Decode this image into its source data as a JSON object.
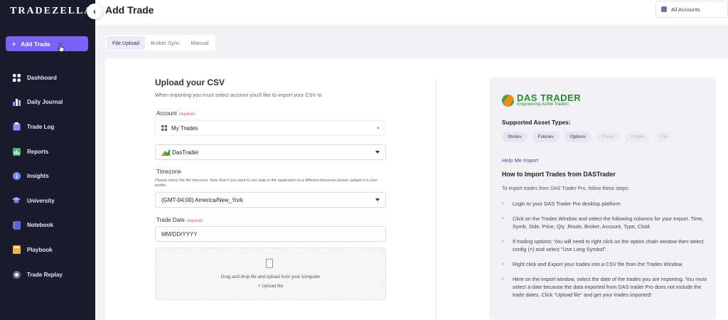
{
  "app": {
    "logo_text": "TRADEZELLA"
  },
  "sidebar": {
    "add_trade_label": "Add Trade",
    "items": [
      {
        "label": "Dashboard",
        "icon": "dashboard-icon"
      },
      {
        "label": "Daily Journal",
        "icon": "bar-chart-icon"
      },
      {
        "label": "Trade Log",
        "icon": "clipboard-icon"
      },
      {
        "label": "Reports",
        "icon": "report-icon"
      },
      {
        "label": "Insights",
        "icon": "info-icon"
      },
      {
        "label": "University",
        "icon": "graduation-cap-icon"
      },
      {
        "label": "Notebook",
        "icon": "notebook-icon"
      },
      {
        "label": "Playbook",
        "icon": "playbook-icon"
      },
      {
        "label": "Trade Replay",
        "icon": "replay-icon"
      }
    ]
  },
  "header": {
    "title": "Add Trade",
    "account_selector": "All Accounts"
  },
  "tabs": [
    "File Upload",
    "Broker Sync",
    "Manual"
  ],
  "form": {
    "title": "Upload your CSV",
    "subtitle": "When importing you must select account you'll like to import your CSV to",
    "account_label": "Account",
    "required_text": "required",
    "account_value": "My Trades",
    "broker_value": "DasTrader",
    "timezone_label": "Timezone",
    "timezone_help": "Please select the file timezone. Note that if you want to see data in the application in a different timezone please update it in your profile.",
    "timezone_value": "(GMT-04:00) America/New_York",
    "trade_date_label": "Trade Date",
    "trade_date_placeholder": "MM/DD/YYYY",
    "dropzone_text": "Drag and drop file and upload from your computer",
    "upload_link": "+ Upload file"
  },
  "info_panel": {
    "brand_name": "DAS TRADER",
    "brand_tagline": "Empowering Active Traders",
    "supported_title": "Supported Asset Types:",
    "asset_types": [
      {
        "label": "Stocks",
        "enabled": true
      },
      {
        "label": "Futures",
        "enabled": true
      },
      {
        "label": "Options",
        "enabled": true
      },
      {
        "label": "Forex",
        "enabled": false
      },
      {
        "label": "Crypto",
        "enabled": false
      },
      {
        "label": "Cfd",
        "enabled": false
      }
    ],
    "help_link": "Help Me Import",
    "how_title": "How to Import Trades from DASTrader",
    "how_intro": "To import trades from DAS Trader Pro, follow these steps:",
    "steps": [
      "Login to your DAS Trader Pro desktop platform",
      "Click on the Trades Window and select the following columns for your export. Time, Symb, Side, Price, Qty ,Route, Broker, Account, Type, Cloid",
      "If trading options: You will need to right click on the option chain window then select config (=) and select \"Use Long Symbol\".",
      "Right click and Export your trades into a CSV file from the Trades Window.",
      "Here on the import window, select the date of the trades you are importing. You must select a date because the data exported from DAS trader Pro does not include the trade dates. Click \"Upload file\" and get your trades imported!"
    ]
  }
}
